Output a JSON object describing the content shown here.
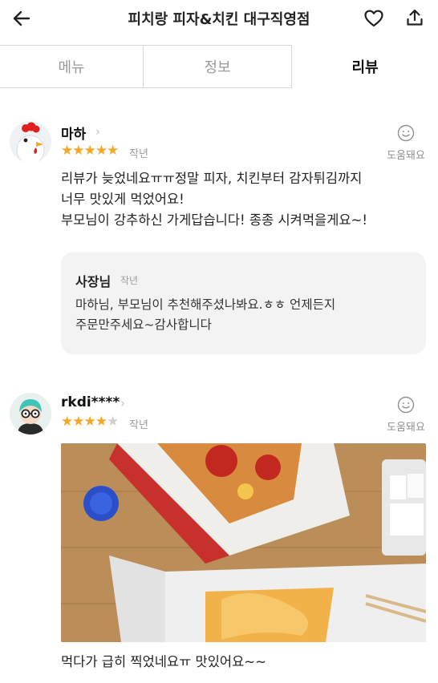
{
  "header": {
    "title": "피치랑 피자&치킨 대구직영점",
    "back_icon": "arrow-left-icon",
    "heart_icon": "heart-icon",
    "share_icon": "share-icon"
  },
  "tabs": [
    {
      "label": "메뉴",
      "active": false
    },
    {
      "label": "정보",
      "active": false
    },
    {
      "label": "리뷰",
      "active": true
    }
  ],
  "reviews": [
    {
      "author": "마하",
      "rating": 5,
      "stars_filled": "★★★★★",
      "stars_empty": "",
      "date": "작년",
      "helpful_label": "도움돼요",
      "text_lines": [
        "리뷰가 늦었네요ㅠㅠ정말 피자, 치킨부터 감자튀김까지",
        "너무 맛있게 먹었어요!",
        "부모님이 강추하신 가게답습니다! 종종 시켜먹을게요~!"
      ],
      "reply": {
        "author": "사장님",
        "date": "작년",
        "text_lines": [
          "마하님, 부모님이 추천해주셨나봐요.ㅎㅎ 언제든지",
          "주문만주세요~감사합니다"
        ]
      }
    },
    {
      "author": "rkdi****",
      "rating": 4,
      "stars_filled": "★★★★",
      "stars_empty": "★",
      "date": "작년",
      "helpful_label": "도움돼요",
      "text_lines": [
        "먹다가 급히 찍었네요ㅠ 맛있어요~~"
      ]
    }
  ],
  "colors": {
    "star": "#f5a623",
    "star_empty": "#cfcfcf",
    "reply_bg": "#f3f3f3"
  }
}
